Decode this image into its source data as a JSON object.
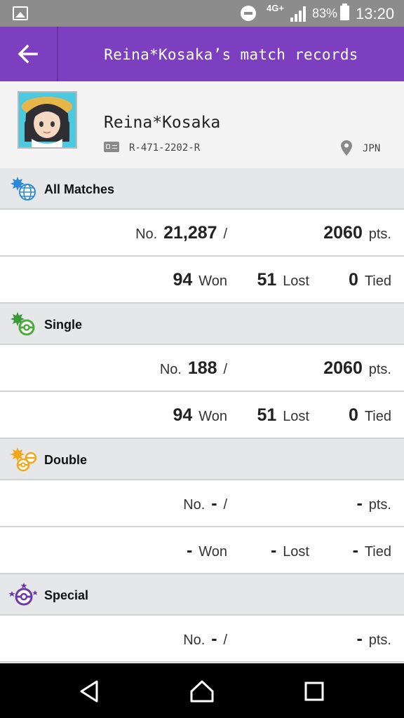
{
  "status_bar": {
    "network": "4G+",
    "battery": "83%",
    "time": "13:20"
  },
  "header": {
    "title": "Reina*Kosaka’s match records"
  },
  "profile": {
    "name": "Reina*Kosaka",
    "id": "R-471-2202-R",
    "region": "JPN"
  },
  "sections": [
    {
      "title": "All Matches",
      "icon": "globe-battle-icon",
      "rank": "21,287",
      "points": "2060",
      "won": "94",
      "lost": "51",
      "tied": "0",
      "has_results": true
    },
    {
      "title": "Single",
      "icon": "single-battle-icon",
      "rank": "188",
      "points": "2060",
      "won": "94",
      "lost": "51",
      "tied": "0",
      "has_results": true
    },
    {
      "title": "Double",
      "icon": "double-battle-icon",
      "rank": "-",
      "points": "-",
      "won": "-",
      "lost": "-",
      "tied": "-",
      "has_results": true
    },
    {
      "title": "Special",
      "icon": "special-battle-icon",
      "rank": "-",
      "points": "-",
      "has_results": false
    }
  ],
  "labels": {
    "no": "No.",
    "slash": "/",
    "pts": "pts.",
    "won": "Won",
    "lost": "Lost",
    "tied": "Tied"
  },
  "colors": {
    "header_bg": "#7b3fbf",
    "status_bar_bg": "#8c8c8c",
    "section_bg": "#e6e7e9"
  }
}
